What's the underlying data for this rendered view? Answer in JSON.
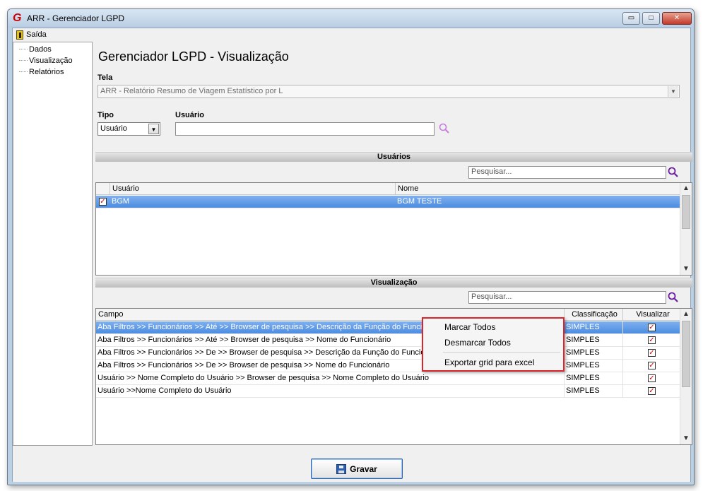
{
  "window": {
    "title": "ARR - Gerenciador LGPD",
    "icon": "G",
    "controls": {
      "minimize": "▭",
      "maximize": "□",
      "close": "✕"
    }
  },
  "menu": {
    "exit_label": "Saída"
  },
  "tree": {
    "items": [
      "Dados",
      "Visualização",
      "Relatórios"
    ]
  },
  "page": {
    "title": "Gerenciador LGPD - Visualização",
    "tela_label": "Tela",
    "tela_value": "ARR - Relatório Resumo de Viagem Estatístico por L",
    "tipo_label": "Tipo",
    "tipo_value": "Usuário",
    "usuario_label": "Usuário",
    "usuario_value": ""
  },
  "users_section": {
    "header": "Usuários",
    "search_placeholder": "Pesquisar...",
    "columns": [
      "Usuário",
      "Nome"
    ],
    "rows": [
      {
        "checked": true,
        "usuario": "BGM",
        "nome": "BGM TESTE"
      }
    ]
  },
  "view_section": {
    "header": "Visualização",
    "search_placeholder": "Pesquisar...",
    "columns": [
      "Campo",
      "Classificação",
      "Visualizar"
    ],
    "rows": [
      {
        "campo": "Aba Filtros >> Funcionários >> Até >> Browser de pesquisa >> Descrição da Função do Funcionário",
        "classificacao": "SIMPLES",
        "visualizar": true
      },
      {
        "campo": "Aba Filtros >> Funcionários >> Até >> Browser de pesquisa >> Nome do Funcionário",
        "classificacao": "SIMPLES",
        "visualizar": true
      },
      {
        "campo": "Aba Filtros >> Funcionários >> De >> Browser de pesquisa >> Descrição da Função do Funcionário",
        "classificacao": "SIMPLES",
        "visualizar": true
      },
      {
        "campo": "Aba Filtros >> Funcionários >> De >> Browser de pesquisa >> Nome do Funcionário",
        "classificacao": "SIMPLES",
        "visualizar": true
      },
      {
        "campo": "Usuário >> Nome Completo do Usuário >> Browser de pesquisa >> Nome Completo do Usuário",
        "classificacao": "SIMPLES",
        "visualizar": true
      },
      {
        "campo": "Usuário >>Nome Completo do Usuário",
        "classificacao": "SIMPLES",
        "visualizar": true
      }
    ]
  },
  "context_menu": {
    "items": [
      "Marcar Todos",
      "Desmarcar Todos",
      "Exportar grid para excel"
    ]
  },
  "footer": {
    "save_label": "Gravar"
  },
  "icons": {
    "check": "✓",
    "scroll_up": "▲",
    "scroll_down": "▼",
    "combo_arrow": "▼"
  },
  "colors": {
    "accent_selection": "#4d8ce0",
    "context_border": "#d9262c",
    "search_icon": "#6a1fa0"
  }
}
